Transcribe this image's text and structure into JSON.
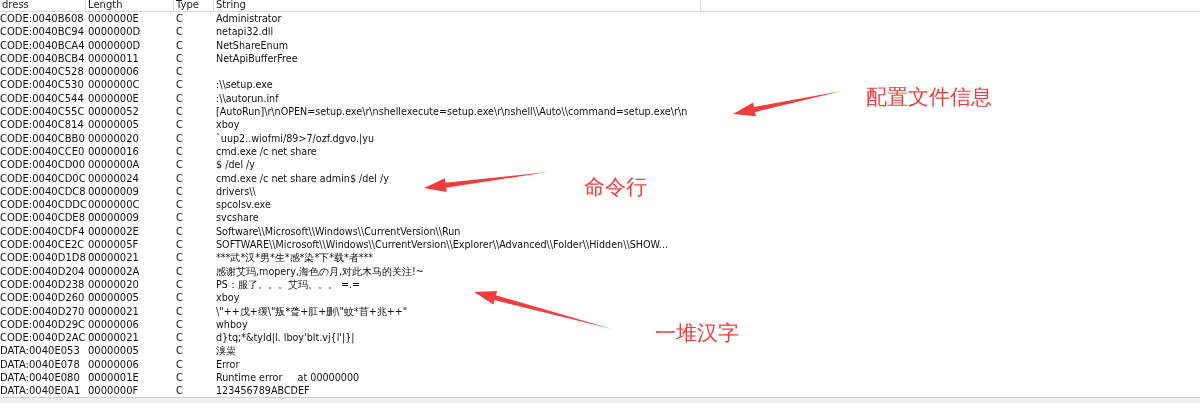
{
  "table": {
    "columns": [
      "dress",
      "Length",
      "Type",
      "String"
    ],
    "rows": [
      {
        "address": "CODE:0040B608",
        "length": "0000000E",
        "type": "C",
        "string": "Administrator"
      },
      {
        "address": "CODE:0040BC94",
        "length": "0000000D",
        "type": "C",
        "string": "netapi32.dll"
      },
      {
        "address": "CODE:0040BCA4",
        "length": "0000000D",
        "type": "C",
        "string": "NetShareEnum"
      },
      {
        "address": "CODE:0040BCB4",
        "length": "00000011",
        "type": "C",
        "string": "NetApiBufferFree"
      },
      {
        "address": "CODE:0040C528",
        "length": "00000006",
        "type": "C"
      },
      {
        "address": "CODE:0040C530",
        "length": "0000000C",
        "type": "C",
        "string": ":\\\\setup.exe"
      },
      {
        "address": "CODE:0040C544",
        "length": "0000000E",
        "type": "C",
        "string": ":\\\\autorun.inf"
      },
      {
        "address": "CODE:0040C55C",
        "length": "00000052",
        "type": "C",
        "string": "[AutoRun]\\r\\nOPEN=setup.exe\\r\\nshellexecute=setup.exe\\r\\nshell\\\\Auto\\\\command=setup.exe\\r\\n"
      },
      {
        "address": "CODE:0040C814",
        "length": "00000005",
        "type": "C",
        "string": "xboy"
      },
      {
        "address": "CODE:0040CBB0",
        "length": "00000020",
        "type": "C",
        "string": "`uup2..wiofmi/89>7/ozf.dgvo.|yu"
      },
      {
        "address": "CODE:0040CCE0",
        "length": "00000016",
        "type": "C",
        "string": "cmd.exe /c net share"
      },
      {
        "address": "CODE:0040CD00",
        "length": "0000000A",
        "type": "C",
        "string": "$ /del /y"
      },
      {
        "address": "CODE:0040CD0C",
        "length": "00000024",
        "type": "C",
        "string": "cmd.exe /c net share admin$ /del /y"
      },
      {
        "address": "CODE:0040CDC8",
        "length": "00000009",
        "type": "C",
        "string": "drivers\\\\"
      },
      {
        "address": "CODE:0040CDDC",
        "length": "0000000C",
        "type": "C",
        "string": "spcolsv.exe"
      },
      {
        "address": "CODE:0040CDE8",
        "length": "00000009",
        "type": "C",
        "string": "svcshare"
      },
      {
        "address": "CODE:0040CDF4",
        "length": "0000002E",
        "type": "C",
        "string": "Software\\\\Microsoft\\\\Windows\\\\CurrentVersion\\\\Run"
      },
      {
        "address": "CODE:0040CE2C",
        "length": "0000005F",
        "type": "C",
        "string": "SOFTWARE\\\\Microsoft\\\\Windows\\\\CurrentVersion\\\\Explorer\\\\Advanced\\\\Folder\\\\Hidden\\\\SHOW..."
      },
      {
        "address": "CODE:0040D1D8",
        "length": "00000021",
        "type": "C",
        "string": "***武*汉*男*生*感*染*下*载*者***"
      },
      {
        "address": "CODE:0040D204",
        "length": "0000002A",
        "type": "C",
        "string": "感谢艾玛,mopery,海色の月,对此木马的关注!~"
      },
      {
        "address": "CODE:0040D238",
        "length": "00000020",
        "type": "C",
        "string": "PS：服了。。。艾玛。。。 =.="
      },
      {
        "address": "CODE:0040D260",
        "length": "00000005",
        "type": "C",
        "string": "xboy"
      },
      {
        "address": "CODE:0040D270",
        "length": "00000021",
        "type": "C",
        "string": "\\\"++戊+缓\\\"叛*聋+肛+删\\\"蚊*苜+兆++\""
      },
      {
        "address": "CODE:0040D29C",
        "length": "00000006",
        "type": "C",
        "string": "whboy"
      },
      {
        "address": "CODE:0040D2AC",
        "length": "00000021",
        "type": "C",
        "string": "d}tq;*&tyld|l. lboy'blt.vj{l'|}|"
      },
      {
        "address": "DATA:0040E053",
        "length": "00000005",
        "type": "C",
        "string": "溴粜"
      },
      {
        "address": "DATA:0040E078",
        "length": "00000006",
        "type": "C",
        "string": "Error"
      },
      {
        "address": "DATA:0040E080",
        "length": "0000001E",
        "type": "C",
        "string": "Runtime error     at 00000000"
      },
      {
        "address": "DATA:0040E0A1",
        "length": "0000000F",
        "type": "C",
        "string": "123456789ABCDEF"
      }
    ]
  },
  "annotations": [
    {
      "text": "配置文件信息"
    },
    {
      "text": "命令行"
    },
    {
      "text": "一堆汉字"
    }
  ]
}
